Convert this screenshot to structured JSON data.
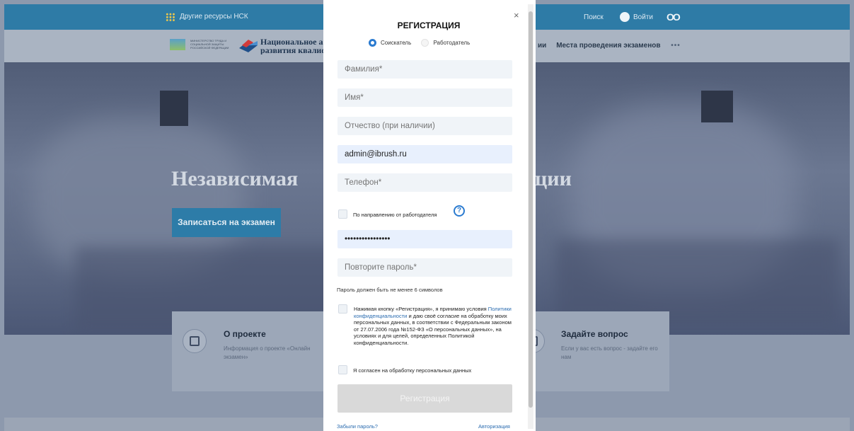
{
  "topbar": {
    "other_resources": "Другие ресурсы НСК",
    "search": "Поиск",
    "login": "Войти",
    "glasses": "OO"
  },
  "header": {
    "ministry": "МИНИСТЕРСТВО ТРУДА И СОЦИАЛЬНОЙ ЗАЩИТЫ РОССИЙСКОЙ ФЕДЕРАЦИИ",
    "org_line1": "Национальное аг",
    "org_line2": "развития квалиф",
    "nav_partial": "ии",
    "nav_exam_places": "Места проведения экзаменов",
    "nav_more": "•••"
  },
  "hero": {
    "title_left": "Независимая",
    "title_right": "ции",
    "exam_button": "Записаться на экзамен"
  },
  "cards": [
    {
      "title": "О проекте",
      "desc": "Информация о проекте «Онлайн экзамен»"
    },
    {
      "title": "Задайте вопрос",
      "desc": "Если у вас есть вопрос - задайте его нам"
    }
  ],
  "modal": {
    "close": "×",
    "title": "РЕГИСТРАЦИЯ",
    "role_applicant": "Соискатель",
    "role_employer": "Работодатель",
    "selected_role": "Соискатель",
    "fields": {
      "lastname_placeholder": "Фамилия*",
      "firstname_placeholder": "Имя*",
      "middlename_placeholder": "Отчество (при наличии)",
      "email_value": "admin@ibrush.ru",
      "phone_placeholder": "Телефон*",
      "password_value": "••••••••••••••••",
      "password_repeat_placeholder": "Повторите пароль*"
    },
    "employer_direction": "По направлению от работодателя",
    "help_icon": "?",
    "password_hint": "Пароль должен быть не менее 6 символов",
    "consent_part1": "Нажимая кнопку «Регистрация», я принимаю условия ",
    "consent_link": "Политики конфиденциальности",
    "consent_part2": " и даю своё согласие на обработку моих персональных данных, в соответствии с Федеральным законом от 27.07.2006 года №152-ФЗ «О персональных данных», на условиях и для целей, определенных Политикой конфиденциальности.",
    "personal_data_agree": "Я согласен на обработку персональных данных",
    "register_button": "Регистрация",
    "forgot_password": "Забыли пароль?",
    "authorization": "Авторизация"
  },
  "colors": {
    "accent": "#2b7bd0",
    "topbar": "#2e7ba6",
    "button_disabled": "#d9d9d9"
  }
}
